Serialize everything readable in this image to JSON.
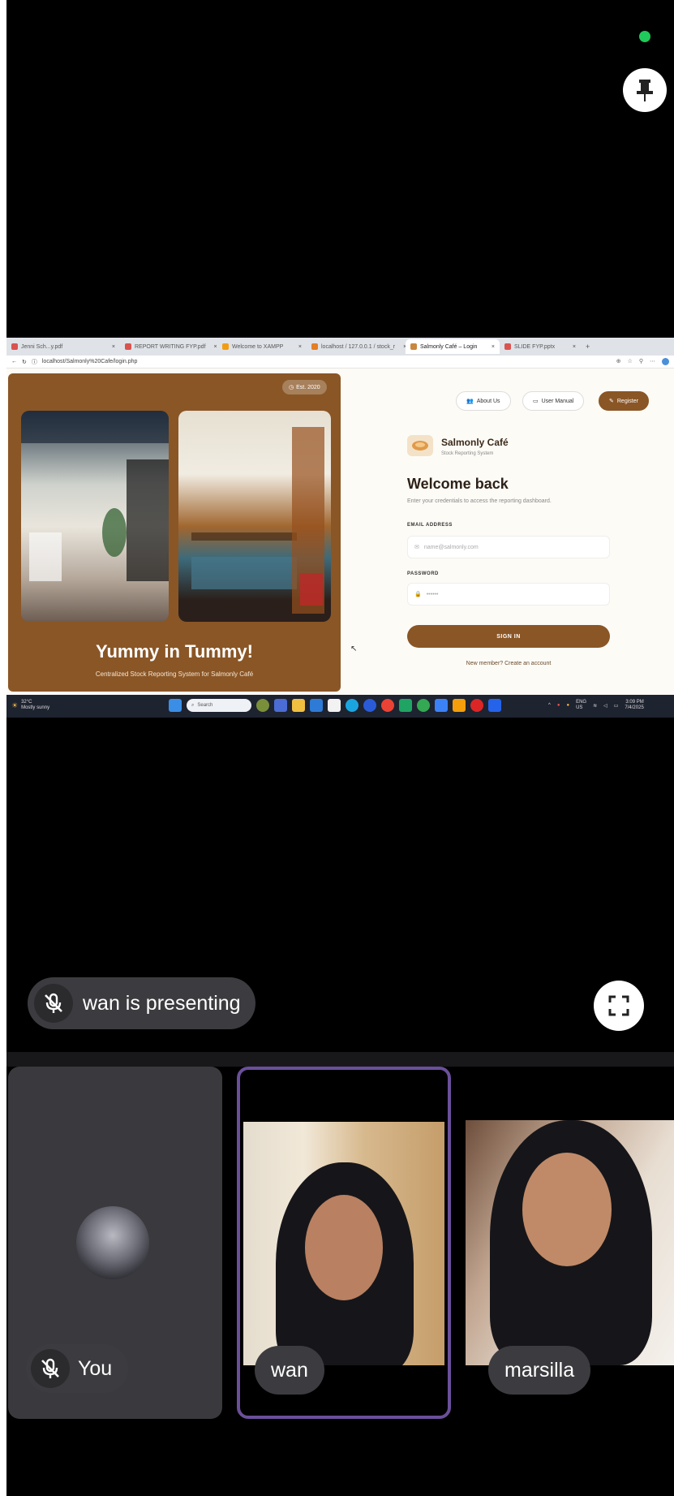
{
  "meeting": {
    "presenting_text": "wan is presenting",
    "participants": [
      {
        "name": "You"
      },
      {
        "name": "wan"
      },
      {
        "name": "marsilla"
      }
    ],
    "recording_indicator_color": "#1fc95b",
    "active_speaker_border_color": "#6b4f9a"
  },
  "shared_screen": {
    "browser": {
      "tabs": [
        {
          "label": "Jenni Sch...y.pdf"
        },
        {
          "label": "REPORT WRITING FYP.pdf"
        },
        {
          "label": "Welcome to XAMPP"
        },
        {
          "label": "localhost / 127.0.0.1 / stock_r"
        },
        {
          "label": "Salmonly Café – Login",
          "active": true
        },
        {
          "label": "SLIDE FYP.pptx"
        }
      ],
      "address": "localhost/Salmonly%20Cafe/login.php"
    },
    "site": {
      "est_badge": "Est. 2020",
      "tagline": "Yummy in Tummy!",
      "sub_tagline": "Centralized Stock Reporting System for Salmonly Café",
      "nav": {
        "about": "About Us",
        "manual": "User Manual",
        "register": "Register"
      },
      "brand_name": "Salmonly Café",
      "brand_sub": "Stock Reporting System",
      "welcome": "Welcome back",
      "welcome_sub": "Enter your credentials to access the reporting dashboard.",
      "email_label": "EMAIL ADDRESS",
      "email_placeholder": "name@salmonly.com",
      "password_label": "PASSWORD",
      "password_placeholder": "••••••",
      "signin": "SIGN IN",
      "create_account": "New member? Create an account",
      "accent_color": "#8a5626"
    },
    "taskbar": {
      "weather_temp": "32°C",
      "weather_desc": "Mostly sunny",
      "search": "Search",
      "lang": "ENG\nUS",
      "time": "3:09 PM",
      "date": "7/4/2025"
    }
  }
}
